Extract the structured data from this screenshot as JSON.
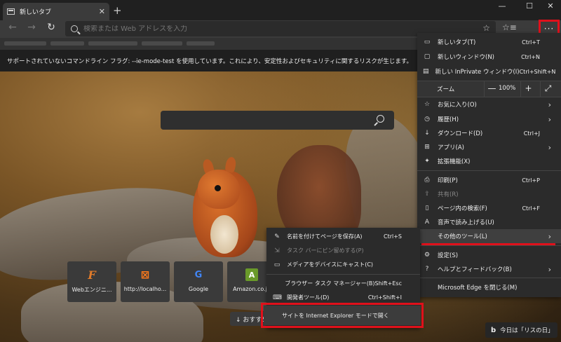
{
  "tab": {
    "title": "新しいタブ",
    "close": "✕"
  },
  "window": {
    "new_tab": "+",
    "minimize": "—",
    "maximize": "☐",
    "close": "✕"
  },
  "toolbar": {
    "back": "←",
    "forward": "→",
    "reload": "↻",
    "address_placeholder": "検索または Web アドレスを入力",
    "favorite_star": "☆",
    "favorites_list": "☆≡",
    "menu": "···"
  },
  "infobar": {
    "message": "サポートされていないコマンドライン フラグ: --ie-mode-test を使用しています。これにより、安定性およびセキュリティに関するリスクが生じます。"
  },
  "tiles": [
    {
      "label": "Webエンジニ...",
      "icon": "F",
      "icon_color": "#e07b2a"
    },
    {
      "label": "http://localho...",
      "icon": "⊠",
      "icon_color": "#ff7a1a"
    },
    {
      "label": "Google",
      "icon": "G",
      "icon_color": "#4285f4"
    },
    {
      "label": "Amazon.co.jp",
      "icon": "A",
      "icon_color": "#6a9a2a"
    }
  ],
  "recommend": {
    "label": "↓ おすすめ"
  },
  "bing": {
    "icon": "b",
    "label": "今日は「リスの日」"
  },
  "menu": {
    "new_tab": {
      "label": "新しいタブ(T)",
      "shortcut": "Ctrl+T"
    },
    "new_window": {
      "label": "新しいウィンドウ(N)",
      "shortcut": "Ctrl+N"
    },
    "new_inprivate": {
      "label": "新しい InPrivate ウィンドウ(I)",
      "shortcut": "Ctrl+Shift+N"
    },
    "zoom": {
      "label": "ズーム",
      "minus": "—",
      "value": "100%",
      "plus": "+",
      "fullscreen": "⤢"
    },
    "favorites": {
      "label": "お気に入り(O)"
    },
    "history": {
      "label": "履歴(H)"
    },
    "downloads": {
      "label": "ダウンロード(D)",
      "shortcut": "Ctrl+J"
    },
    "apps": {
      "label": "アプリ(A)"
    },
    "extensions": {
      "label": "拡張機能(X)"
    },
    "print": {
      "label": "印刷(P)",
      "shortcut": "Ctrl+P"
    },
    "share": {
      "label": "共有(R)"
    },
    "find": {
      "label": "ページ内の検索(F)",
      "shortcut": "Ctrl+F"
    },
    "read_aloud": {
      "label": "音声で読み上げる(U)"
    },
    "more_tools": {
      "label": "その他のツール(L)"
    },
    "settings": {
      "label": "設定(S)"
    },
    "help": {
      "label": "ヘルプとフィードバック(B)"
    },
    "close_edge": {
      "label": "Microsoft Edge を閉じる(M)"
    }
  },
  "submenu": {
    "save_page": {
      "label": "名前を付けてページを保存(A)",
      "shortcut": "Ctrl+S"
    },
    "pin_taskbar": {
      "label": "タスク バーにピン留めする(P)"
    },
    "cast": {
      "label": "メディアをデバイスにキャスト(C)"
    },
    "task_manager": {
      "label": "ブラウザー タスク マネージャー(B)",
      "shortcut": "Shift+Esc"
    },
    "dev_tools": {
      "label": "開発者ツール(D)",
      "shortcut": "Ctrl+Shift+I"
    },
    "ie_mode": {
      "label": "サイトを Internet Explorer モードで開く"
    }
  }
}
